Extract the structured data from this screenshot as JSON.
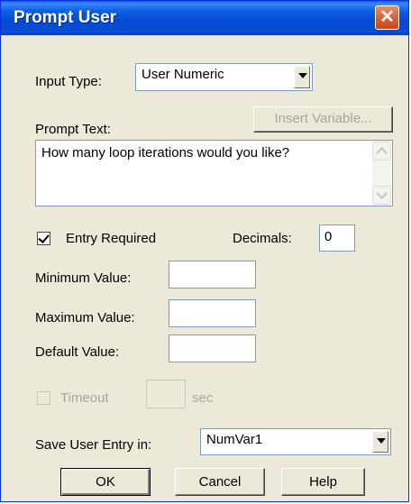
{
  "window": {
    "title": "Prompt User",
    "close_symbol": "✕"
  },
  "input_type": {
    "label": "Input Type:",
    "value": "User Numeric"
  },
  "prompt_text": {
    "label": "Prompt Text:",
    "insert_variable_label": "Insert Variable...",
    "value": "How many loop iterations would you like?"
  },
  "entry_required": {
    "label": "Entry Required",
    "checked": true
  },
  "decimals": {
    "label": "Decimals:",
    "value": "0"
  },
  "minimum": {
    "label": "Minimum Value:",
    "value": ""
  },
  "maximum": {
    "label": "Maximum Value:",
    "value": ""
  },
  "default": {
    "label": "Default Value:",
    "value": ""
  },
  "timeout": {
    "label": "Timeout",
    "unit": "sec",
    "value": "",
    "enabled": false
  },
  "save_entry": {
    "label": "Save User Entry in:",
    "value": "NumVar1"
  },
  "buttons": {
    "ok": "OK",
    "cancel": "Cancel",
    "help": "Help"
  },
  "colors": {
    "titlebar": "#0549d2",
    "dialog_bg": "#ece9d8",
    "close_button": "#d85a2e",
    "disabled_text": "#a7a69c"
  }
}
